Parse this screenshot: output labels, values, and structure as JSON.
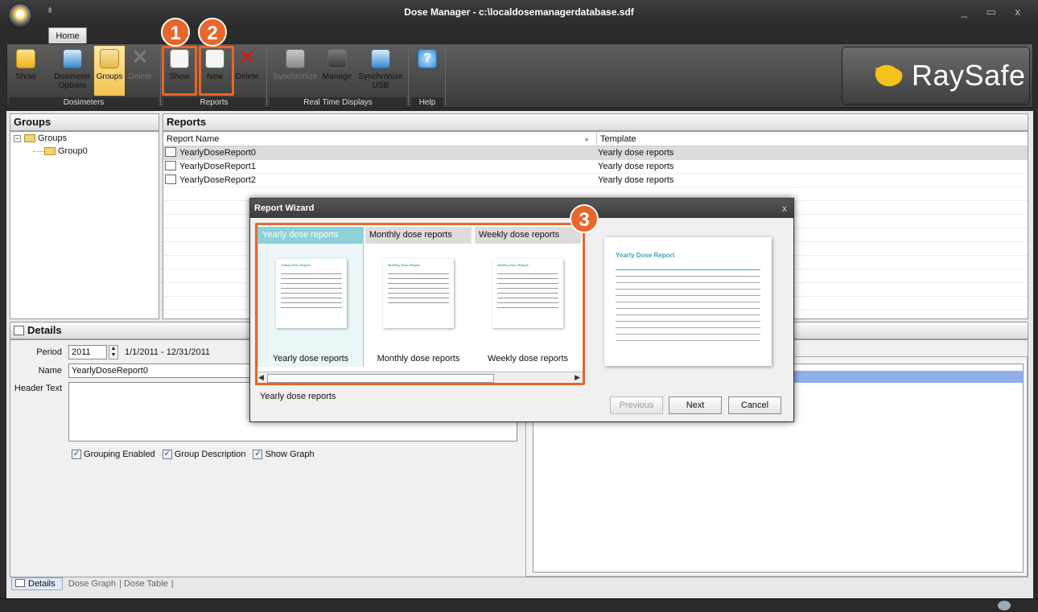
{
  "window": {
    "title": "Dose Manager - c:\\localdosemanagerdatabase.sdf",
    "controls": "_ ▭ x",
    "qat": "⇟"
  },
  "ribbon": {
    "tab": "Home",
    "groups": {
      "dosimeters": "Dosimeters",
      "reports": "Reports",
      "realtime": "Real Time Displays",
      "help": "Help"
    },
    "buttons": {
      "show": "Show",
      "dosimeter_options": "Dosimeter Options",
      "groups": "Groups",
      "delete": "Delete",
      "report_show": "Show",
      "report_new": "New",
      "report_delete": "Delete",
      "synchronize": "Synchronize",
      "manage": "Manage",
      "synchronize_usb": "Synchronize USB"
    }
  },
  "logo": {
    "text": "RaySafe",
    "color": "#f5c21c"
  },
  "annotations": {
    "badge1": "1",
    "badge2": "2",
    "badge3": "3",
    "accent": "#e8662a"
  },
  "groups_pane": {
    "title": "Groups",
    "root": "Groups",
    "children": [
      "Group0"
    ]
  },
  "reports_pane": {
    "title": "Reports",
    "columns": [
      "Report Name",
      "Template"
    ],
    "rows": [
      {
        "name": "YearlyDoseReport0",
        "template": "Yearly dose reports"
      },
      {
        "name": "YearlyDoseReport1",
        "template": "Yearly dose reports"
      },
      {
        "name": "YearlyDoseReport2",
        "template": "Yearly dose reports"
      }
    ]
  },
  "details": {
    "title": "Details",
    "period_label": "Period",
    "period_value": "2011",
    "period_range": "1/1/2011 - 12/31/2011",
    "name_label": "Name",
    "name_value": "YearlyDoseReport0",
    "header_text_label": "Header Text",
    "grouping_enabled": "Grouping Enabled",
    "group_description": "Group Description",
    "show_graph": "Show Graph"
  },
  "bottom_tabs": [
    "Details",
    "Dose Graph",
    "Dose Table"
  ],
  "wizard": {
    "title": "Report Wizard",
    "close": "x",
    "templates": [
      "Yearly dose reports",
      "Monthly dose reports",
      "Weekly dose reports"
    ],
    "thumb_titles": [
      "Yearly Dose Report",
      "Monthly Dose Report",
      "Weekly Dose Report"
    ],
    "preview_title": "Yearly Dose Report",
    "selected_description": "Yearly dose reports",
    "buttons": {
      "previous": "Previous",
      "next": "Next",
      "cancel": "Cancel"
    }
  }
}
